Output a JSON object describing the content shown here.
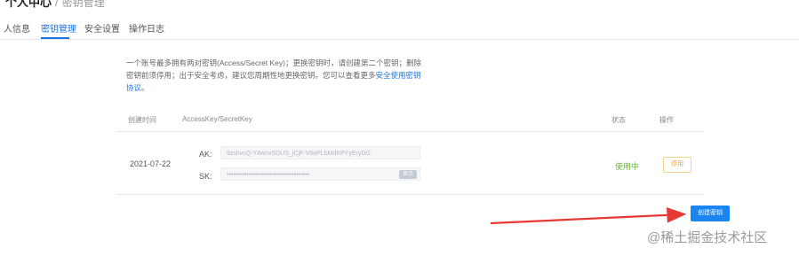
{
  "header": {
    "title": "个人中心",
    "subtitle": "密钥管理"
  },
  "tabs": [
    {
      "label": "人信息"
    },
    {
      "label": "密钥管理",
      "active": true
    },
    {
      "label": "安全设置"
    },
    {
      "label": "操作日志"
    }
  ],
  "description": {
    "text": "一个账号最多拥有两对密钥(Access/Secret Key)；更换密钥时，请创建第二个密钥；删除密钥前须停用；出于安全考虑，建议您周期性地更换密钥。您可以查看更多",
    "link": "安全使用密钥协议。"
  },
  "table": {
    "headers": [
      "创建时间",
      "AccessKey/SecretKey",
      "状态",
      "操作"
    ],
    "rows": [
      {
        "created": "2021-07-22",
        "ak_label": "AK:",
        "ak_value": "8zshvcQ-Y4wnvSDUS_jCjF-V6ePLbMdKPYyEryDG",
        "sk_label": "SK:",
        "sk_value": "••••••••••••••••••••••••••••••••••••••",
        "view_label": "显示",
        "status": "使用中",
        "action": "停用"
      }
    ]
  },
  "create_button": "创建密钥",
  "watermark": "@稀土掘金技术社区",
  "colors": {
    "accent": "#1a84f1",
    "status_ok": "#67b33a",
    "arrow": "#e53935",
    "warn": "#e5a640"
  }
}
